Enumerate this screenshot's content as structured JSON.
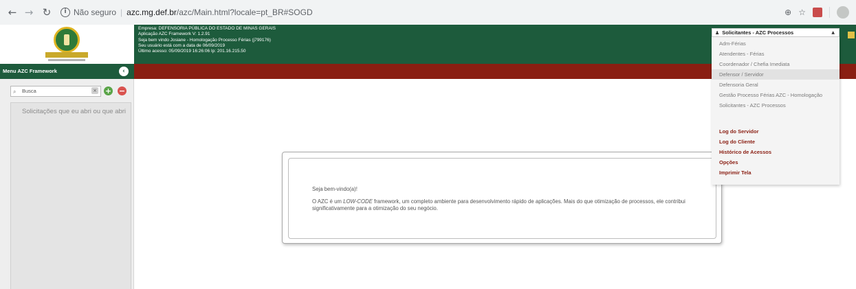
{
  "browser": {
    "security_label": "Não seguro",
    "url_host": "azc.mg.def.br",
    "url_path": "/azc/Main.html?locale=pt_BR#SOGD"
  },
  "header": {
    "lines": [
      "Empresa: DEFENSORIA PÚBLICA DO ESTADO DE MINAS GERAIS",
      "Aplicação AZC Framework V: 1.2.91",
      "Seja bem vindo Josiane - Homologação Processo Férias (j799176)",
      "Seu usuário está com a data de 06/09/2019",
      "Último acesso: 05/09/2019 16:26:06 Ip: 201.16.215.50"
    ]
  },
  "sidebar": {
    "title": "Menu AZC Framework",
    "search_placeholder": "Busca",
    "panel_title": "Solicitações que eu abri ou que abri"
  },
  "dialog": {
    "greeting": "Seja bem-vindo(a)!",
    "body_pre": "O AZC é um ",
    "body_em": "LOW-CODE",
    "body_post": " framework, um completo ambiente para desenvolvimento rápido de aplicações. Mais do que otimização de processos, ele contribui significativamente para a otimização do seu negócio."
  },
  "profile_menu": {
    "selected": "Solicitantes - AZC Processos",
    "profiles": [
      "Adm-Férias",
      "Atendentes - Férias",
      "Coordenador / Chefia Imediata",
      "Defensor / Servidor",
      "Defensoria Geral",
      "Gestão Processo Férias AZC - Homologação",
      "Solicitantes - AZC Processos"
    ],
    "highlighted_index": 3,
    "links": [
      "Log do Servidor",
      "Log do Cliente",
      "Histórico de Acessos",
      "Opções",
      "Imprimir Tela"
    ]
  },
  "colors": {
    "header_green": "#1d5b3c",
    "bar_red": "#8a1e12",
    "link_red": "#8a1e12"
  }
}
